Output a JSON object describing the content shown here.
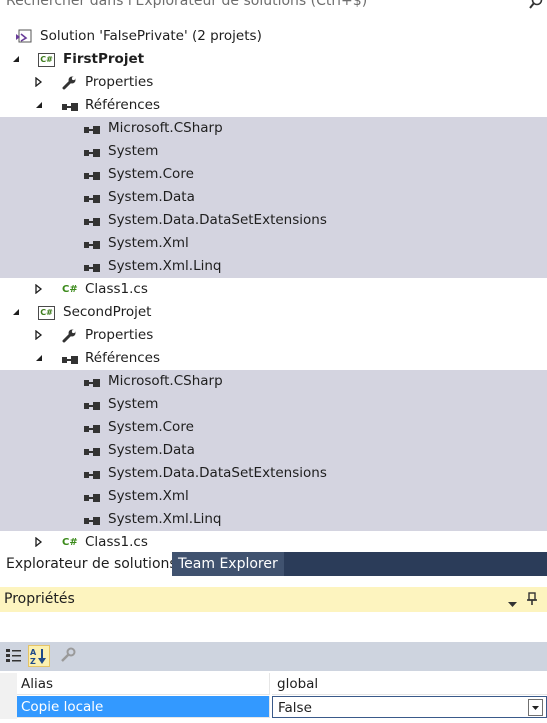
{
  "search": {
    "placeholder": "Rechercher dans l'Explorateur de solutions (Ctrl+$)"
  },
  "solution": {
    "label": "Solution 'FalsePrivate' (2 projets)"
  },
  "projects": [
    {
      "name": "FirstProjet",
      "properties_label": "Properties",
      "references_label": "Références",
      "references": [
        "Microsoft.CSharp",
        "System",
        "System.Core",
        "System.Data",
        "System.Data.DataSetExtensions",
        "System.Xml",
        "System.Xml.Linq"
      ],
      "file": "Class1.cs"
    },
    {
      "name": "SecondProjet",
      "properties_label": "Properties",
      "references_label": "Références",
      "references": [
        "Microsoft.CSharp",
        "System",
        "System.Core",
        "System.Data",
        "System.Data.DataSetExtensions",
        "System.Xml",
        "System.Xml.Linq"
      ],
      "file": "Class1.cs"
    }
  ],
  "cs_badge": "C#",
  "tabs": {
    "solution_explorer": "Explorateur de solutions",
    "team_explorer": "Team Explorer"
  },
  "properties": {
    "title": "Propriétés",
    "rows": [
      {
        "name": "Alias",
        "value": "global"
      },
      {
        "name": "Copie locale",
        "value": "False"
      }
    ]
  },
  "colors": {
    "selection_bg": "#d4d4e0",
    "tab_bar": "#2b3c59",
    "properties_header": "#fdf4bf",
    "grid_selection": "#3399ff"
  },
  "icons": [
    "search-icon",
    "solution-icon",
    "csharp-project-icon",
    "wrench-icon",
    "references-icon",
    "reference-item-icon",
    "csharp-file-icon",
    "categorized-icon",
    "alphabetical-icon",
    "property-pages-icon",
    "dropdown-icon",
    "pin-icon"
  ]
}
